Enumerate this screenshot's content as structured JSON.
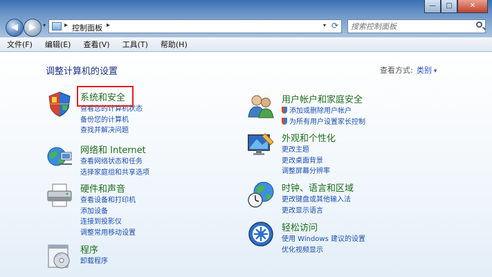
{
  "window": {
    "controls": {
      "minimize": "—",
      "maximize": "□",
      "close": "✕"
    }
  },
  "nav": {
    "back_glyph": "◀",
    "forward_glyph": "▶",
    "dropdown_glyph": "▾",
    "address": {
      "separator": "▸",
      "path": "控制面板",
      "dropdown_glyph": "▾",
      "refresh_glyph": "⟳"
    },
    "search_placeholder": "搜索控制面板"
  },
  "menubar": {
    "items": [
      "文件(F)",
      "编辑(E)",
      "查看(V)",
      "工具(T)",
      "帮助(H)"
    ]
  },
  "page": {
    "title": "调整计算机的设置",
    "view_by_label": "查看方式:",
    "view_by_value": "类别"
  },
  "categories": {
    "system_security": {
      "icon": "shield-icon",
      "title": "系统和安全",
      "links": [
        "查看您的计算机状态",
        "备份您的计算机",
        "查找并解决问题"
      ]
    },
    "network_internet": {
      "icon": "network-globe-icon",
      "title": "网络和 Internet",
      "links": [
        "查看网络状态和任务",
        "选择家庭组和共享选项"
      ]
    },
    "hardware_sound": {
      "icon": "printer-icon",
      "title": "硬件和声音",
      "links": [
        "查看设备和打印机",
        "添加设备",
        "连接到投影仪",
        "调整常用移动设置"
      ]
    },
    "programs": {
      "icon": "programs-icon",
      "title": "程序",
      "links": [
        "卸载程序"
      ]
    },
    "user_accounts": {
      "icon": "users-icon",
      "title": "用户帐户和家庭安全",
      "links": [
        "添加或删除用户帐户",
        "为所有用户设置家长控制"
      ]
    },
    "appearance": {
      "icon": "display-icon",
      "title": "外观和个性化",
      "links": [
        "更改主题",
        "更改桌面背景",
        "调整屏幕分辨率"
      ]
    },
    "clock_region": {
      "icon": "clock-globe-icon",
      "title": "时钟、语言和区域",
      "links": [
        "更改键盘或其他输入法",
        "更改显示语言"
      ]
    },
    "ease_of_access": {
      "icon": "ease-of-access-icon",
      "title": "轻松访问",
      "links": [
        "使用 Windows 建议的设置",
        "优化视频显示"
      ]
    }
  },
  "colors": {
    "category_title": "#1f6e1f",
    "link": "#1d4fb0",
    "page_title": "#1e3287",
    "highlight": "#e02020"
  }
}
